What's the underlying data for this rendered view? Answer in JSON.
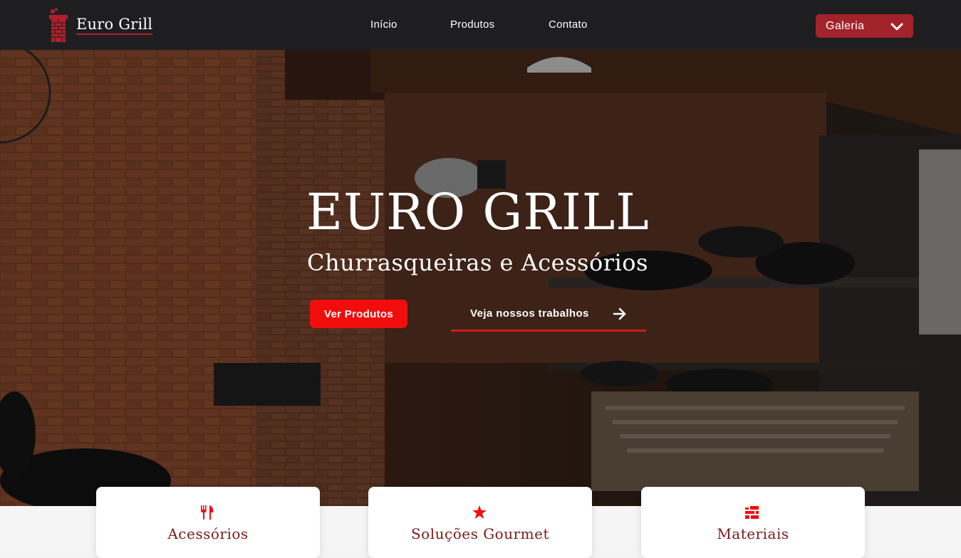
{
  "brand": {
    "name": "Euro Grill"
  },
  "nav": {
    "items": [
      {
        "label": "Início"
      },
      {
        "label": "Produtos"
      },
      {
        "label": "Contato"
      }
    ],
    "dropdown": {
      "label": "Galeria",
      "icon": "chevron-down-icon"
    }
  },
  "hero": {
    "title": "EURO GRILL",
    "subtitle": "Churrasqueiras e Acessórios",
    "primary_button": "Ver Produtos",
    "secondary_link": "Veja nossos trabalhos",
    "secondary_icon": "arrow-right-icon"
  },
  "cards": [
    {
      "title": "Acessórios",
      "icon": "utensils-icon"
    },
    {
      "title": "Soluções Gourmet",
      "icon": "star-icon"
    },
    {
      "title": "Materiais",
      "icon": "bricks-icon"
    }
  ],
  "colors": {
    "navbar_bg": "#1e1e20",
    "accent_dark_red": "#a3232a",
    "accent_bright_red": "#f20d0d",
    "card_title": "#7a1a1a"
  }
}
